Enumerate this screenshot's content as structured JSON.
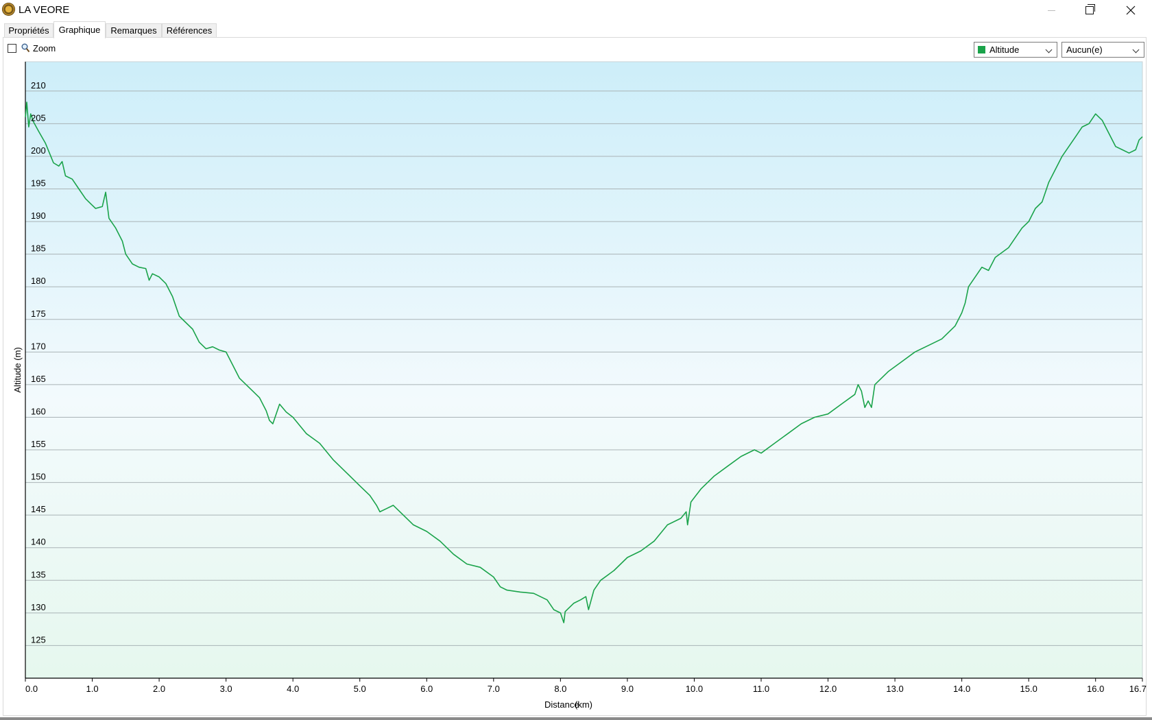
{
  "window": {
    "title": "LA VEORE",
    "controls": [
      "minimize",
      "maximize",
      "close"
    ]
  },
  "tabs": [
    {
      "label": "Propriétés",
      "active": false
    },
    {
      "label": "Graphique",
      "active": true
    },
    {
      "label": "Remarques",
      "active": false
    },
    {
      "label": "Références",
      "active": false
    }
  ],
  "toolbar": {
    "zoom_label": "Zoom",
    "zoom_checked": false,
    "series_select": {
      "value": "Altitude",
      "color": "#1aa34a"
    },
    "second_select": {
      "value": "Aucun(e)"
    }
  },
  "colors": {
    "line": "#1aa34a",
    "gradient_top": "#cdeef9",
    "gradient_mid": "#f3fafd",
    "gradient_bottom": "#e6f8ee",
    "grid": "#a9b3b6"
  },
  "chart_data": {
    "type": "line",
    "xlabel": "Distance",
    "xunit": "(km)",
    "ylabel": "Altitude (m)",
    "xlim": [
      0,
      16.7
    ],
    "ylim": [
      120,
      214.5
    ],
    "xticks": [
      {
        "value": 0.0,
        "label": "0.0"
      },
      {
        "value": 1.0,
        "label": "1.0"
      },
      {
        "value": 2.0,
        "label": "2.0"
      },
      {
        "value": 3.0,
        "label": "3.0"
      },
      {
        "value": 4.0,
        "label": "4.0"
      },
      {
        "value": 5.0,
        "label": "5.0"
      },
      {
        "value": 6.0,
        "label": "6.0"
      },
      {
        "value": 7.0,
        "label": "7.0"
      },
      {
        "value": 8.0,
        "label": "8.0"
      },
      {
        "value": 9.0,
        "label": "9.0"
      },
      {
        "value": 10.0,
        "label": "10.0"
      },
      {
        "value": 11.0,
        "label": "11.0"
      },
      {
        "value": 12.0,
        "label": "12.0"
      },
      {
        "value": 13.0,
        "label": "13.0"
      },
      {
        "value": 14.0,
        "label": "14.0"
      },
      {
        "value": 15.0,
        "label": "15.0"
      },
      {
        "value": 16.0,
        "label": "16.0"
      },
      {
        "value": 16.7,
        "label": "16.7"
      }
    ],
    "yticks": [
      125,
      130,
      135,
      140,
      145,
      150,
      155,
      160,
      165,
      170,
      175,
      180,
      185,
      190,
      195,
      200,
      205,
      210
    ],
    "grid": true,
    "series": [
      {
        "color": "#1aa34a",
        "x": [
          0.0,
          0.02,
          0.05,
          0.08,
          0.12,
          0.2,
          0.3,
          0.38,
          0.42,
          0.5,
          0.55,
          0.6,
          0.7,
          0.8,
          0.9,
          1.0,
          1.05,
          1.15,
          1.2,
          1.25,
          1.35,
          1.45,
          1.5,
          1.6,
          1.7,
          1.8,
          1.85,
          1.9,
          2.0,
          2.1,
          2.2,
          2.3,
          2.4,
          2.5,
          2.6,
          2.7,
          2.8,
          2.9,
          3.0,
          3.1,
          3.2,
          3.3,
          3.4,
          3.5,
          3.6,
          3.65,
          3.7,
          3.8,
          3.9,
          4.0,
          4.2,
          4.4,
          4.6,
          4.8,
          5.0,
          5.15,
          5.25,
          5.3,
          5.4,
          5.5,
          5.6,
          5.8,
          6.0,
          6.2,
          6.4,
          6.6,
          6.8,
          7.0,
          7.1,
          7.2,
          7.4,
          7.6,
          7.8,
          7.9,
          8.0,
          8.05,
          8.07,
          8.1,
          8.2,
          8.3,
          8.38,
          8.42,
          8.5,
          8.6,
          8.8,
          9.0,
          9.2,
          9.4,
          9.6,
          9.8,
          9.88,
          9.9,
          9.95,
          10.1,
          10.3,
          10.5,
          10.7,
          10.9,
          11.0,
          11.2,
          11.4,
          11.6,
          11.8,
          12.0,
          12.2,
          12.4,
          12.45,
          12.5,
          12.55,
          12.6,
          12.65,
          12.7,
          12.9,
          13.1,
          13.3,
          13.5,
          13.7,
          13.9,
          14.0,
          14.05,
          14.1,
          14.3,
          14.4,
          14.5,
          14.7,
          14.9,
          15.0,
          15.1,
          15.2,
          15.3,
          15.5,
          15.7,
          15.8,
          15.9,
          16.0,
          16.1,
          16.2,
          16.3,
          16.4,
          16.5,
          16.6,
          16.65,
          16.7
        ],
        "y": [
          206.0,
          208.3,
          204.5,
          206.5,
          205.3,
          203.8,
          202.0,
          200.0,
          199.0,
          198.5,
          199.2,
          197.0,
          196.5,
          195.0,
          193.5,
          192.5,
          192.0,
          192.3,
          194.5,
          190.5,
          189.0,
          187.0,
          185.0,
          183.5,
          183.0,
          182.8,
          181.0,
          182.0,
          181.5,
          180.5,
          178.5,
          175.5,
          174.5,
          173.5,
          171.5,
          170.5,
          170.8,
          170.3,
          170.0,
          168.0,
          166.0,
          165.0,
          164.0,
          163.0,
          161.0,
          159.5,
          159.0,
          162.0,
          160.8,
          160.0,
          157.5,
          156.0,
          153.5,
          151.5,
          149.5,
          148.0,
          146.5,
          145.5,
          146.0,
          146.5,
          145.5,
          143.5,
          142.5,
          141.0,
          139.0,
          137.5,
          137.0,
          135.5,
          134.0,
          133.5,
          133.2,
          133.0,
          132.0,
          130.5,
          130.0,
          128.5,
          130.2,
          130.5,
          131.5,
          132.0,
          132.5,
          130.5,
          133.5,
          135.0,
          136.5,
          138.5,
          139.5,
          141.0,
          143.5,
          144.5,
          145.5,
          143.5,
          147.0,
          149.0,
          151.0,
          152.5,
          154.0,
          155.0,
          154.5,
          156.0,
          157.5,
          159.0,
          160.0,
          160.5,
          162.0,
          163.5,
          165.0,
          164.0,
          161.5,
          162.5,
          161.5,
          165.0,
          167.0,
          168.5,
          170.0,
          171.0,
          172.0,
          174.0,
          176.0,
          177.5,
          180.0,
          183.0,
          182.5,
          184.5,
          186.0,
          189.0,
          190.0,
          192.0,
          193.0,
          196.0,
          200.0,
          203.0,
          204.5,
          205.0,
          206.5,
          205.5,
          203.5,
          201.5,
          201.0,
          200.5,
          201.0,
          202.5,
          203.0
        ]
      }
    ]
  }
}
